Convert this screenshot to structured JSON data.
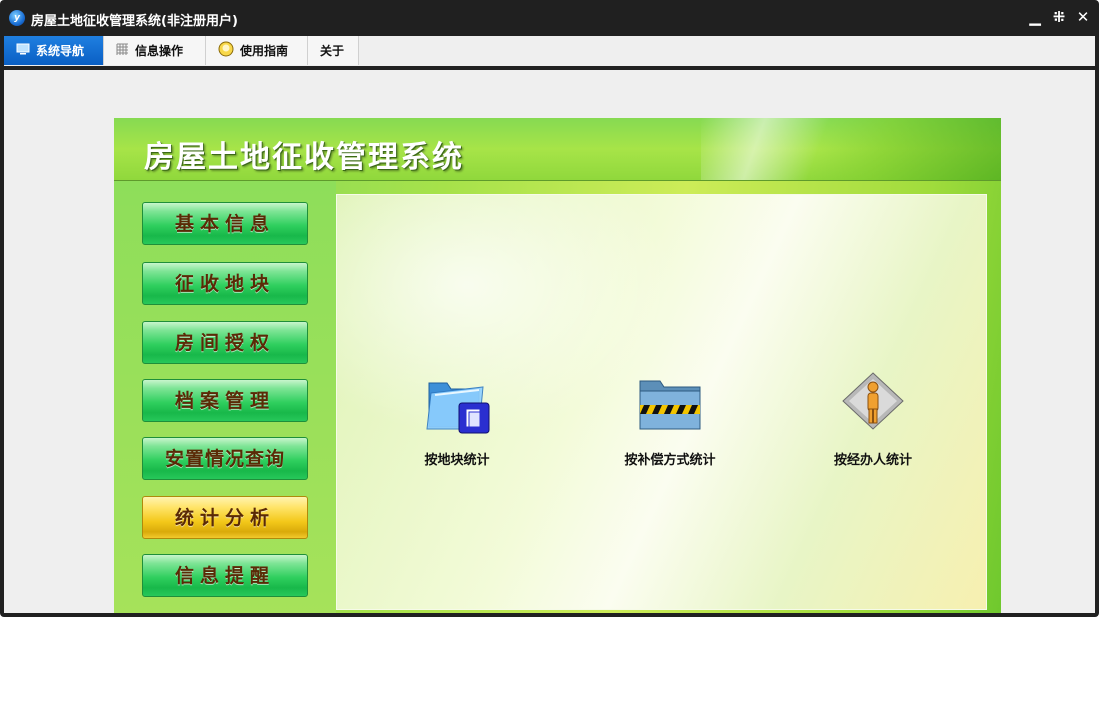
{
  "window": {
    "title": "房屋土地征收管理系统(非注册用户)",
    "app_icon_letter": "y",
    "minimize_glyph": "▁",
    "restore_glyph": "⁜",
    "close_glyph": "✕"
  },
  "menu": {
    "items": [
      {
        "label": "系统导航",
        "icon": "monitor-icon",
        "active": true
      },
      {
        "label": "信息操作",
        "icon": "grid-icon",
        "active": false
      },
      {
        "label": "使用指南",
        "icon": "help-icon",
        "active": false
      },
      {
        "label": "关于",
        "icon": "",
        "active": false
      }
    ]
  },
  "panel": {
    "title": "房屋土地征收管理系统"
  },
  "sidebar": {
    "items": [
      {
        "label": "基本信息",
        "selected": false
      },
      {
        "label": "征收地块",
        "selected": false
      },
      {
        "label": "房间授权",
        "selected": false
      },
      {
        "label": "档案管理",
        "selected": false
      },
      {
        "label": "安置情况查询",
        "selected": false
      },
      {
        "label": "统计分析",
        "selected": true
      },
      {
        "label": "信息提醒",
        "selected": false
      }
    ]
  },
  "main": {
    "items": [
      {
        "label": "按地块统计",
        "icon": "folder-document-icon"
      },
      {
        "label": "按补偿方式统计",
        "icon": "folder-tape-icon"
      },
      {
        "label": "按经办人统计",
        "icon": "person-icon"
      }
    ]
  },
  "colors": {
    "accent_blue": "#0a5fc4",
    "nav_green": "#18b84a",
    "nav_selected_gold": "#f3c81a",
    "nav_text": "#5a2a06"
  }
}
